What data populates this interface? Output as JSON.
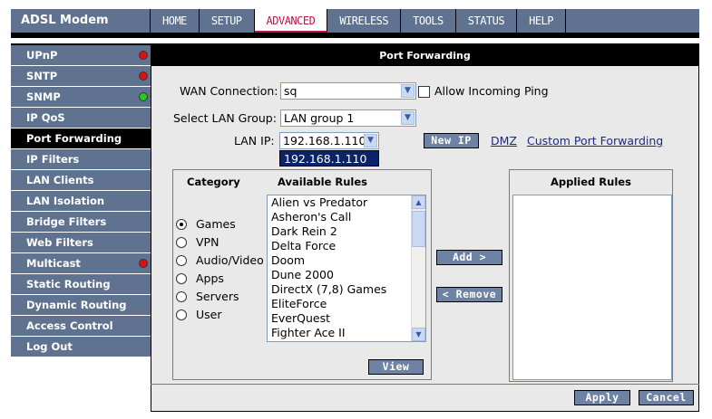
{
  "brand": "ADSL Modem",
  "nav": {
    "tabs": [
      {
        "label": "HOME"
      },
      {
        "label": "SETUP"
      },
      {
        "label": "ADVANCED",
        "active": true
      },
      {
        "label": "WIRELESS"
      },
      {
        "label": "TOOLS"
      },
      {
        "label": "STATUS"
      },
      {
        "label": "HELP"
      }
    ]
  },
  "sidebar": {
    "items": [
      {
        "label": "UPnP",
        "status": "red"
      },
      {
        "label": "SNTP",
        "status": "red"
      },
      {
        "label": "SNMP",
        "status": "green"
      },
      {
        "label": "IP QoS"
      },
      {
        "label": "Port Forwarding",
        "active": true
      },
      {
        "label": "IP Filters"
      },
      {
        "label": "LAN Clients"
      },
      {
        "label": "LAN Isolation"
      },
      {
        "label": "Bridge Filters"
      },
      {
        "label": "Web Filters"
      },
      {
        "label": "Multicast",
        "status": "red"
      },
      {
        "label": "Static Routing"
      },
      {
        "label": "Dynamic Routing"
      },
      {
        "label": "Access Control"
      },
      {
        "label": "Log Out"
      }
    ]
  },
  "page": {
    "title": "Port Forwarding",
    "wan_label": "WAN Connection:",
    "wan_value": "sq",
    "allow_ping_label": "Allow Incoming Ping",
    "lan_group_label": "Select LAN Group:",
    "lan_group_value": "LAN group 1",
    "lan_ip_label": "LAN IP:",
    "lan_ip_value": "192.168.1.110",
    "lan_ip_dropdown_option": "192.168.1.110",
    "new_ip_button": "New IP",
    "dmz_link": "DMZ",
    "custom_link": "Custom Port Forwarding"
  },
  "category": {
    "title": "Category",
    "options": [
      {
        "label": "Games",
        "checked": true
      },
      {
        "label": "VPN"
      },
      {
        "label": "Audio/Video"
      },
      {
        "label": "Apps"
      },
      {
        "label": "Servers"
      },
      {
        "label": "User"
      }
    ]
  },
  "available": {
    "title": "Available Rules",
    "items": [
      "Alien vs Predator",
      "Asheron's Call",
      "Dark Rein 2",
      "Delta Force",
      "Doom",
      "Dune 2000",
      "DirectX (7,8) Games",
      "EliteForce",
      "EverQuest",
      "Fighter Ace II"
    ]
  },
  "applied": {
    "title": "Applied Rules"
  },
  "buttons": {
    "add": "Add >",
    "remove": "< Remove",
    "view": "View",
    "apply": "Apply",
    "cancel": "Cancel"
  },
  "colors": {
    "nav_bg": "#5f7391",
    "active_tab_text": "#c01048",
    "status_red": "#e01010",
    "status_green": "#22cc22",
    "button_bg": "#6e82a4",
    "dropdown_highlight": "#0a246a"
  }
}
